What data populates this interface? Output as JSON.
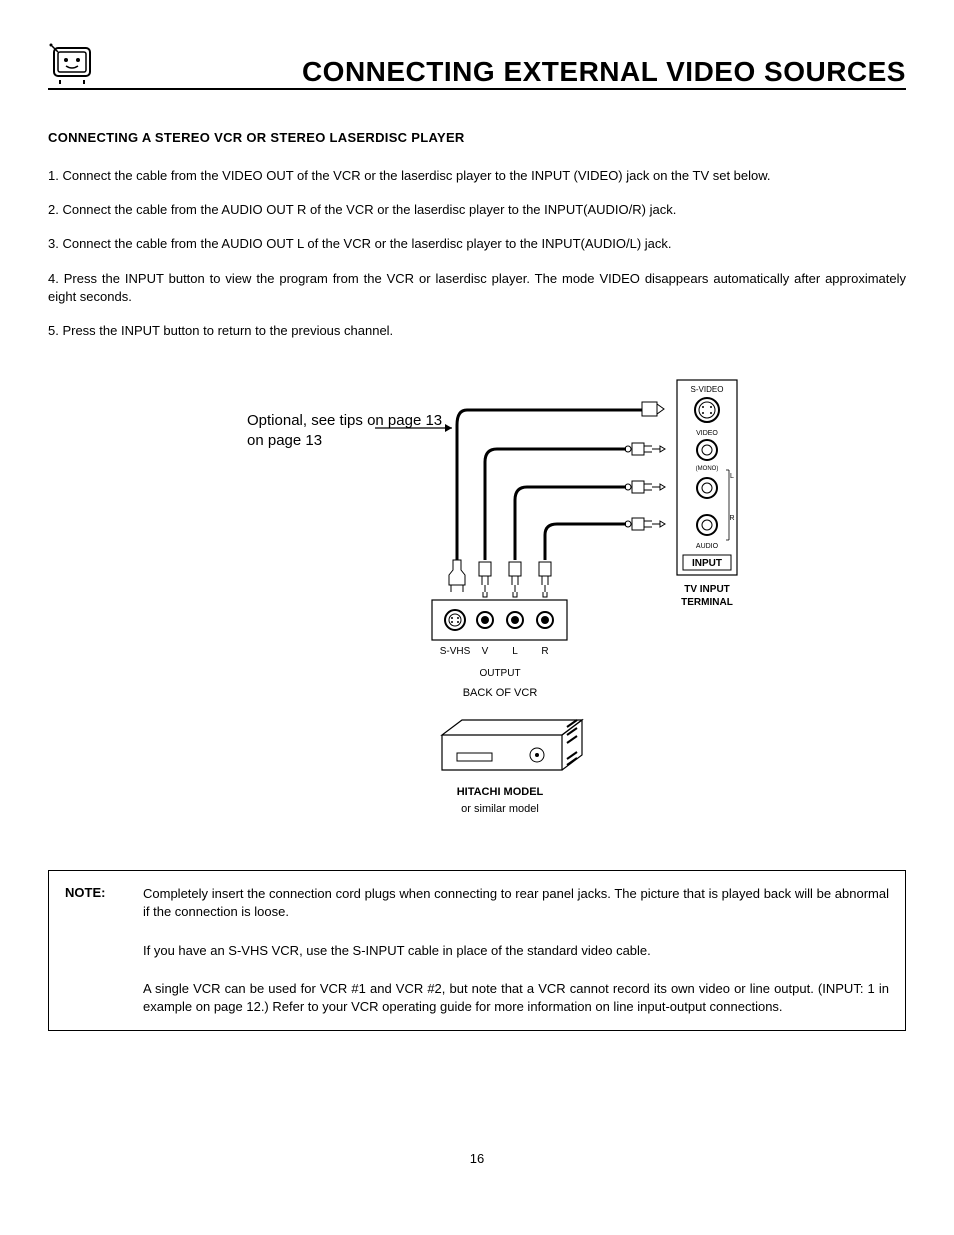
{
  "header": {
    "title": "CONNECTING EXTERNAL VIDEO SOURCES"
  },
  "subheading": "CONNECTING A STEREO VCR OR STEREO LASERDISC PLAYER",
  "steps": [
    "1. Connect the cable from the VIDEO OUT of the VCR or the laserdisc player to the INPUT (VIDEO) jack on the TV set below.",
    "2.  Connect the cable from the AUDIO OUT R of the VCR or the laserdisc player to the INPUT(AUDIO/R) jack.",
    "3.  Connect the cable from the AUDIO OUT L of the VCR or the laserdisc player to the INPUT(AUDIO/L) jack.",
    "4.  Press the INPUT button to view the program from the VCR or laserdisc player.  The mode VIDEO disappears automatically after approximately eight seconds.",
    "5.  Press the INPUT button to return to the previous channel."
  ],
  "diagram": {
    "optional_label": "Optional, see tips on page 13",
    "svideo": "S-VIDEO",
    "video": "VIDEO",
    "mono": "(MONO)",
    "l": "L",
    "r": "R",
    "audio": "AUDIO",
    "input": "INPUT",
    "tv_input_terminal": "TV INPUT TERMINAL",
    "svhs": "S-VHS",
    "v": "V",
    "output": "OUTPUT",
    "back_of_vcr": "BACK OF VCR",
    "hitachi_model": "HITACHI MODEL",
    "or_similar": "or similar model"
  },
  "note": {
    "label": "NOTE:",
    "p1": "Completely insert the connection cord plugs when connecting to rear panel jacks.  The picture that is played back will be abnormal if the connection is loose.",
    "p2": "If you have an S-VHS VCR, use the S-INPUT cable in place of the standard video cable.",
    "p3": "A single VCR can be used for VCR #1 and VCR #2, but note that a VCR cannot record its own video or line output. (INPUT: 1 in example on page 12.)  Refer to your VCR operating guide for more information on line input-output connections."
  },
  "page_number": "16"
}
